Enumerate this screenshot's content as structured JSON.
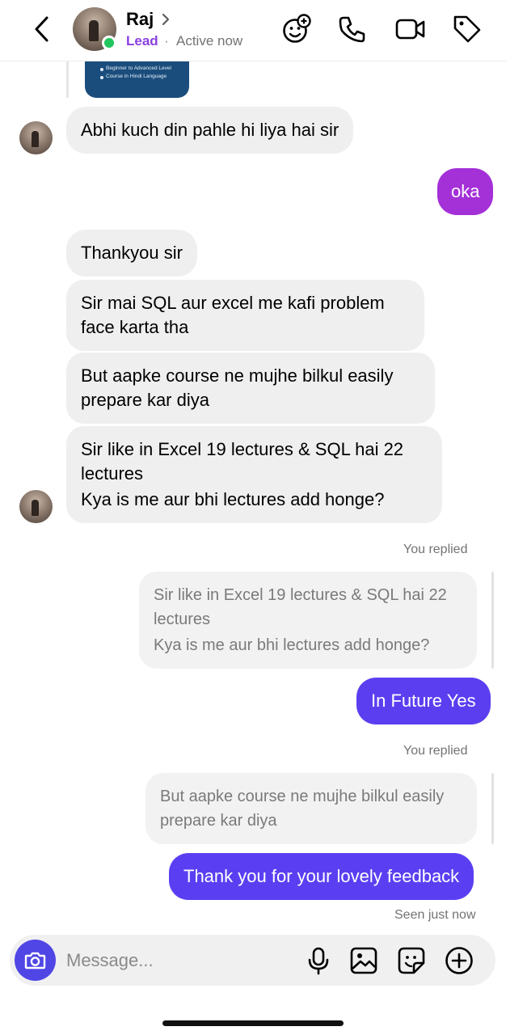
{
  "header": {
    "name": "Raj",
    "label": "Lead",
    "separator": "·",
    "status": "Active now",
    "icons": [
      "back-icon",
      "chevron-right-icon",
      "add-reaction-icon",
      "phone-icon",
      "video-icon",
      "tag-icon"
    ]
  },
  "shared_card": {
    "lines": [
      "Beginner to Advanced Level",
      "Course in Hindi Language"
    ]
  },
  "messages": [
    {
      "direction": "in",
      "text": "Abhi kuch din pahle hi liya hai sir"
    },
    {
      "direction": "out",
      "text": "oka"
    },
    {
      "direction": "in",
      "text": "Thankyou sir"
    },
    {
      "direction": "in",
      "line1": "Sir mai SQL aur excel me kafi problem",
      "line2": "face karta tha"
    },
    {
      "direction": "in",
      "line1": "But aapke course ne mujhe bilkul easily",
      "line2": "prepare kar diya"
    },
    {
      "direction": "in",
      "line1": "Sir like in Excel 19 lectures & SQL hai 22",
      "line2": "lectures",
      "line3": "Kya is me aur bhi lectures add honge?"
    },
    {
      "direction": "out",
      "replied_label": "You replied",
      "quoted_line1": "Sir like in Excel 19 lectures & SQL hai 22",
      "quoted_line2": "lectures",
      "quoted_line3": "Kya is me aur bhi lectures add honge?",
      "text": "In Future Yes"
    },
    {
      "direction": "out",
      "replied_label": "You replied",
      "quoted_line1": "But aapke course ne mujhe bilkul easily",
      "quoted_line2": "prepare kar diya",
      "text": "Thank you for your lovely feedback"
    }
  ],
  "seen_status": "Seen just now",
  "composer": {
    "placeholder": "Message...",
    "icons": [
      "camera-icon",
      "microphone-icon",
      "gallery-icon",
      "sticker-icon",
      "add-icon"
    ]
  },
  "colors": {
    "accent_purple": "#a430d8",
    "accent_violet": "#5b3ef0",
    "lead_label": "#8b3fe0",
    "online": "#22c55e",
    "incoming_bubble": "#efeff0"
  }
}
